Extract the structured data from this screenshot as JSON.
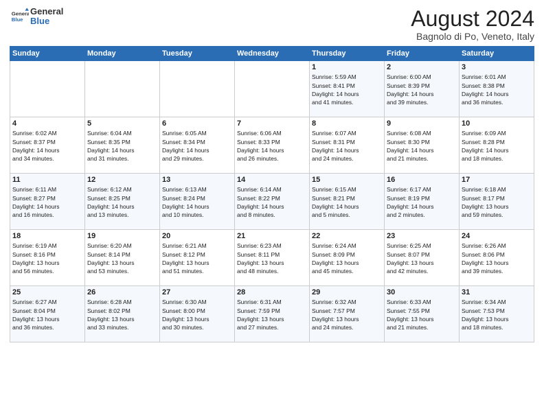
{
  "logo": {
    "line1": "General",
    "line2": "Blue"
  },
  "header": {
    "month_year": "August 2024",
    "location": "Bagnolo di Po, Veneto, Italy"
  },
  "weekdays": [
    "Sunday",
    "Monday",
    "Tuesday",
    "Wednesday",
    "Thursday",
    "Friday",
    "Saturday"
  ],
  "weeks": [
    [
      {
        "day": "",
        "info": ""
      },
      {
        "day": "",
        "info": ""
      },
      {
        "day": "",
        "info": ""
      },
      {
        "day": "",
        "info": ""
      },
      {
        "day": "1",
        "info": "Sunrise: 5:59 AM\nSunset: 8:41 PM\nDaylight: 14 hours\nand 41 minutes."
      },
      {
        "day": "2",
        "info": "Sunrise: 6:00 AM\nSunset: 8:39 PM\nDaylight: 14 hours\nand 39 minutes."
      },
      {
        "day": "3",
        "info": "Sunrise: 6:01 AM\nSunset: 8:38 PM\nDaylight: 14 hours\nand 36 minutes."
      }
    ],
    [
      {
        "day": "4",
        "info": "Sunrise: 6:02 AM\nSunset: 8:37 PM\nDaylight: 14 hours\nand 34 minutes."
      },
      {
        "day": "5",
        "info": "Sunrise: 6:04 AM\nSunset: 8:35 PM\nDaylight: 14 hours\nand 31 minutes."
      },
      {
        "day": "6",
        "info": "Sunrise: 6:05 AM\nSunset: 8:34 PM\nDaylight: 14 hours\nand 29 minutes."
      },
      {
        "day": "7",
        "info": "Sunrise: 6:06 AM\nSunset: 8:33 PM\nDaylight: 14 hours\nand 26 minutes."
      },
      {
        "day": "8",
        "info": "Sunrise: 6:07 AM\nSunset: 8:31 PM\nDaylight: 14 hours\nand 24 minutes."
      },
      {
        "day": "9",
        "info": "Sunrise: 6:08 AM\nSunset: 8:30 PM\nDaylight: 14 hours\nand 21 minutes."
      },
      {
        "day": "10",
        "info": "Sunrise: 6:09 AM\nSunset: 8:28 PM\nDaylight: 14 hours\nand 18 minutes."
      }
    ],
    [
      {
        "day": "11",
        "info": "Sunrise: 6:11 AM\nSunset: 8:27 PM\nDaylight: 14 hours\nand 16 minutes."
      },
      {
        "day": "12",
        "info": "Sunrise: 6:12 AM\nSunset: 8:25 PM\nDaylight: 14 hours\nand 13 minutes."
      },
      {
        "day": "13",
        "info": "Sunrise: 6:13 AM\nSunset: 8:24 PM\nDaylight: 14 hours\nand 10 minutes."
      },
      {
        "day": "14",
        "info": "Sunrise: 6:14 AM\nSunset: 8:22 PM\nDaylight: 14 hours\nand 8 minutes."
      },
      {
        "day": "15",
        "info": "Sunrise: 6:15 AM\nSunset: 8:21 PM\nDaylight: 14 hours\nand 5 minutes."
      },
      {
        "day": "16",
        "info": "Sunrise: 6:17 AM\nSunset: 8:19 PM\nDaylight: 14 hours\nand 2 minutes."
      },
      {
        "day": "17",
        "info": "Sunrise: 6:18 AM\nSunset: 8:17 PM\nDaylight: 13 hours\nand 59 minutes."
      }
    ],
    [
      {
        "day": "18",
        "info": "Sunrise: 6:19 AM\nSunset: 8:16 PM\nDaylight: 13 hours\nand 56 minutes."
      },
      {
        "day": "19",
        "info": "Sunrise: 6:20 AM\nSunset: 8:14 PM\nDaylight: 13 hours\nand 53 minutes."
      },
      {
        "day": "20",
        "info": "Sunrise: 6:21 AM\nSunset: 8:12 PM\nDaylight: 13 hours\nand 51 minutes."
      },
      {
        "day": "21",
        "info": "Sunrise: 6:23 AM\nSunset: 8:11 PM\nDaylight: 13 hours\nand 48 minutes."
      },
      {
        "day": "22",
        "info": "Sunrise: 6:24 AM\nSunset: 8:09 PM\nDaylight: 13 hours\nand 45 minutes."
      },
      {
        "day": "23",
        "info": "Sunrise: 6:25 AM\nSunset: 8:07 PM\nDaylight: 13 hours\nand 42 minutes."
      },
      {
        "day": "24",
        "info": "Sunrise: 6:26 AM\nSunset: 8:06 PM\nDaylight: 13 hours\nand 39 minutes."
      }
    ],
    [
      {
        "day": "25",
        "info": "Sunrise: 6:27 AM\nSunset: 8:04 PM\nDaylight: 13 hours\nand 36 minutes."
      },
      {
        "day": "26",
        "info": "Sunrise: 6:28 AM\nSunset: 8:02 PM\nDaylight: 13 hours\nand 33 minutes."
      },
      {
        "day": "27",
        "info": "Sunrise: 6:30 AM\nSunset: 8:00 PM\nDaylight: 13 hours\nand 30 minutes."
      },
      {
        "day": "28",
        "info": "Sunrise: 6:31 AM\nSunset: 7:59 PM\nDaylight: 13 hours\nand 27 minutes."
      },
      {
        "day": "29",
        "info": "Sunrise: 6:32 AM\nSunset: 7:57 PM\nDaylight: 13 hours\nand 24 minutes."
      },
      {
        "day": "30",
        "info": "Sunrise: 6:33 AM\nSunset: 7:55 PM\nDaylight: 13 hours\nand 21 minutes."
      },
      {
        "day": "31",
        "info": "Sunrise: 6:34 AM\nSunset: 7:53 PM\nDaylight: 13 hours\nand 18 minutes."
      }
    ]
  ]
}
